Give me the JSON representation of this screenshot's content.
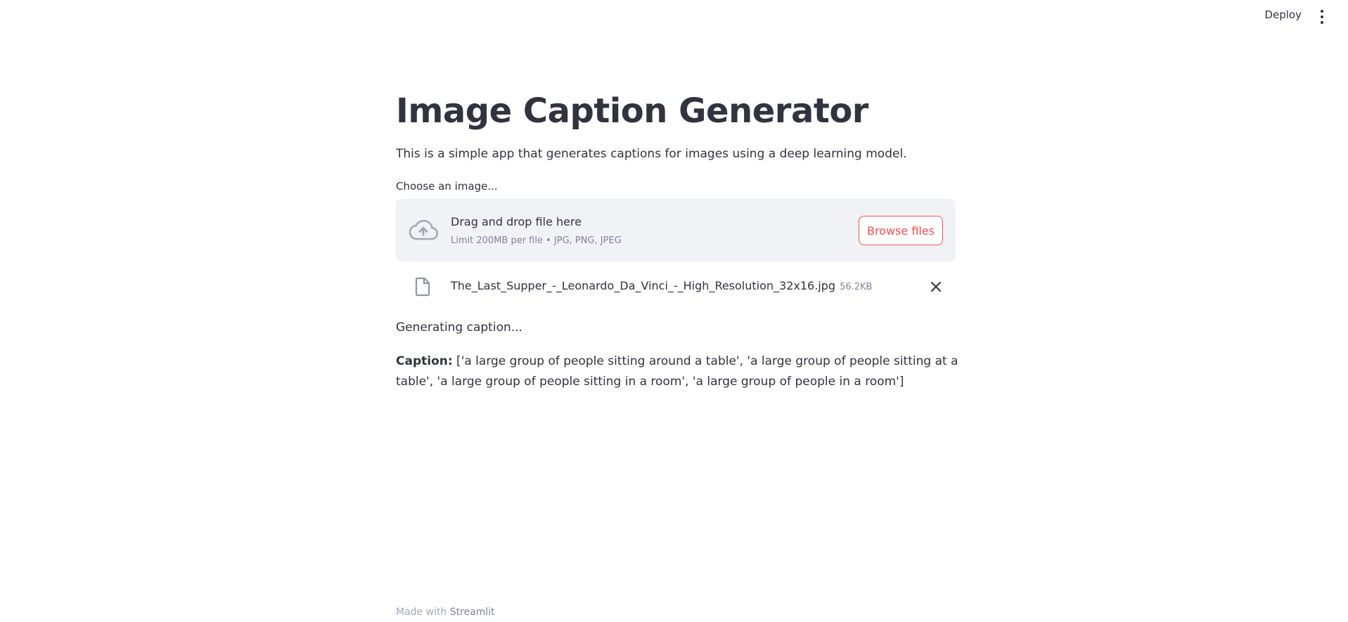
{
  "header": {
    "deploy_label": "Deploy",
    "menu_icon": "vertical-ellipsis-icon"
  },
  "main": {
    "title": "Image Caption Generator",
    "intro": "This is a simple app that generates captions for images using a deep learning model.",
    "uploader": {
      "label": "Choose an image...",
      "drop_title": "Drag and drop file here",
      "drop_hint": "Limit 200MB per file • JPG, PNG, JPEG",
      "browse_label": "Browse files",
      "upload_icon": "cloud-upload-icon"
    },
    "uploaded_file": {
      "name": "The_Last_Supper_-_Leonardo_Da_Vinci_-_High_Resolution_32x16.jpg",
      "size": "56.2KB",
      "file_icon": "file-icon",
      "remove_icon": "close-icon"
    },
    "status": "Generating caption...",
    "caption": {
      "label": "Caption:",
      "text": " ['a large group of people sitting around a table', 'a large group of people sitting at a table', 'a large group of people sitting in a room', 'a large group of people in a room']"
    }
  },
  "footer": {
    "prefix": "Made with ",
    "link": "Streamlit"
  },
  "colors": {
    "text": "#31333f",
    "muted": "#808495",
    "accent": "#ff4b4b",
    "dropzone_bg": "#f0f2f6"
  }
}
